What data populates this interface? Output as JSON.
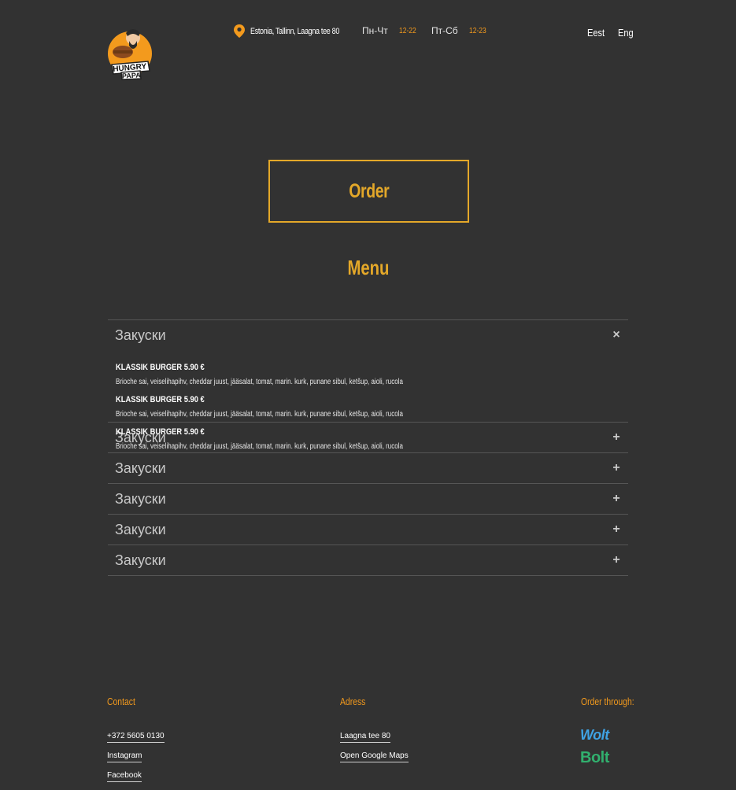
{
  "header": {
    "logo_text": [
      "HUNGRY",
      "PAPA"
    ],
    "location": "Estonia, Tallinn, Laagna tee 80",
    "hours": [
      {
        "days": "Пн-Чт",
        "time": "12-22"
      },
      {
        "days": "Пт-Сб",
        "time": "12-23"
      }
    ],
    "languages": [
      "Eest",
      "Eng"
    ]
  },
  "order_label": "Order",
  "menu_title": "Menu",
  "accordion": {
    "items": [
      {
        "title": "Закуски",
        "open": true,
        "sign": "×"
      },
      {
        "title": "Закуски",
        "open": false,
        "sign": "+"
      },
      {
        "title": "Закуски",
        "open": false,
        "sign": "+"
      },
      {
        "title": "Закуски",
        "open": false,
        "sign": "+"
      },
      {
        "title": "Закуски",
        "open": false,
        "sign": "+"
      },
      {
        "title": "Закуски",
        "open": false,
        "sign": "+"
      }
    ],
    "dishes": [
      {
        "name": "KLASSIK BURGER 5.90 €",
        "desc": "Brioche sai, veiselihapihv, cheddar juust, jääsalat, tomat, marin. kurk, punane sibul, ketšup, aioli, rucola"
      },
      {
        "name": "KLASSIK BURGER 5.90 €",
        "desc": "Brioche sai, veiselihapihv, cheddar juust, jääsalat, tomat, marin. kurk, punane sibul, ketšup, aioli, rucola"
      },
      {
        "name": "KLASSIK BURGER 5.90 €",
        "desc": "Brioche sai, veiselihapihv, cheddar juust, jääsalat, tomat, marin. kurk, punane sibul, ketšup, aioli, rucola"
      }
    ]
  },
  "footer": {
    "contact": {
      "heading": "Contact",
      "links": [
        "+372 5605 0130",
        "Instagram",
        "Facebook"
      ]
    },
    "address": {
      "heading": "Adress",
      "links": [
        "Laagna tee 80",
        "Open Google Maps"
      ]
    },
    "order": {
      "heading": "Order through:",
      "services": [
        "Wolt",
        "Bolt"
      ]
    }
  },
  "colors": {
    "background": "#323232",
    "accent": "#e4a829",
    "orange": "#f39a1d",
    "wolt": "#3fa3e4",
    "bolt": "#31b06e"
  }
}
